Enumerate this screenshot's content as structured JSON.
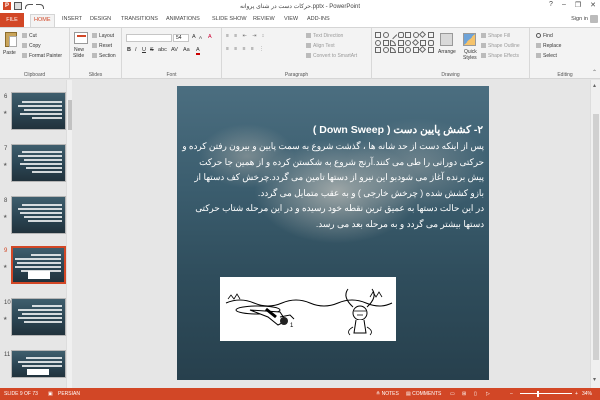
{
  "app": {
    "title": "حرکات دست در شنای پروانه.pptx - PowerPoint",
    "qat_logo": "P"
  },
  "window": {
    "minimize": "–",
    "restore": "❐",
    "close": "✕",
    "help": "?"
  },
  "tabs": [
    "FILE",
    "HOME",
    "INSERT",
    "DESIGN",
    "TRANSITIONS",
    "ANIMATIONS",
    "SLIDE SHOW",
    "REVIEW",
    "VIEW",
    "ADD-INS"
  ],
  "active_tab": "HOME",
  "sign_in": "Sign in",
  "ribbon": {
    "clipboard": {
      "paste": "Paste",
      "cut": "Cut",
      "copy": "Copy",
      "format_painter": "Format Painter",
      "label": "Clipboard"
    },
    "slides": {
      "new_slide_1": "New",
      "new_slide_2": "Slide",
      "layout": "Layout",
      "reset": "Reset",
      "section": "Section",
      "label": "Slides"
    },
    "font": {
      "font_name": "",
      "font_size": "54",
      "grow": "A",
      "shrink": "A",
      "clear": "A",
      "bold": "B",
      "italic": "I",
      "underline": "U",
      "strike": "S",
      "shadow": "abc",
      "spacing": "AV",
      "case": "Aa",
      "color": "A",
      "label": "Font"
    },
    "paragraph": {
      "text_direction": "Text Direction",
      "align_text": "Align Text",
      "convert_smartart": "Convert to SmartArt",
      "label": "Paragraph"
    },
    "drawing": {
      "arrange": "Arrange",
      "quick_styles_1": "Quick",
      "quick_styles_2": "Styles",
      "shape_fill": "Shape Fill",
      "shape_outline": "Shape Outline",
      "shape_effects": "Shape Effects",
      "label": "Drawing"
    },
    "editing": {
      "find": "Find",
      "replace": "Replace",
      "select": "Select",
      "label": "Editing"
    }
  },
  "thumbnails": [
    {
      "num": "6"
    },
    {
      "num": "7"
    },
    {
      "num": "8"
    },
    {
      "num": "9",
      "selected": true
    },
    {
      "num": "10"
    },
    {
      "num": "11"
    }
  ],
  "slide": {
    "title": "۲- کشش پایین دست ( Down Sweep )",
    "body": "پس از اینکه دست از حد شانه ها ، گذشت شروع به سمت پایین و بیرون رفتن کرده و حرکتی دورانی را طی می کنند.آرنج شروع به شکستن کرده و از همین جا حرکت پیش برنده آغاز می شودبو این نیرو از دستها تامین می گردد.چرخش کف دستها از بازو کشش شده ( چرخش خارجی ) و به عقب متمایل می گردد.\nدر این حالت دستها به عمیق ترین نقطه خود رسیده و در این مرحله شتاب حرکتی دستها بیشتر می گردد و به مرحله بعد می رسد."
  },
  "statusbar": {
    "slide_info": "SLIDE 9 OF 73",
    "language": "PERSIAN",
    "notes": "NOTES",
    "comments": "COMMENTS",
    "zoom": "34%"
  }
}
